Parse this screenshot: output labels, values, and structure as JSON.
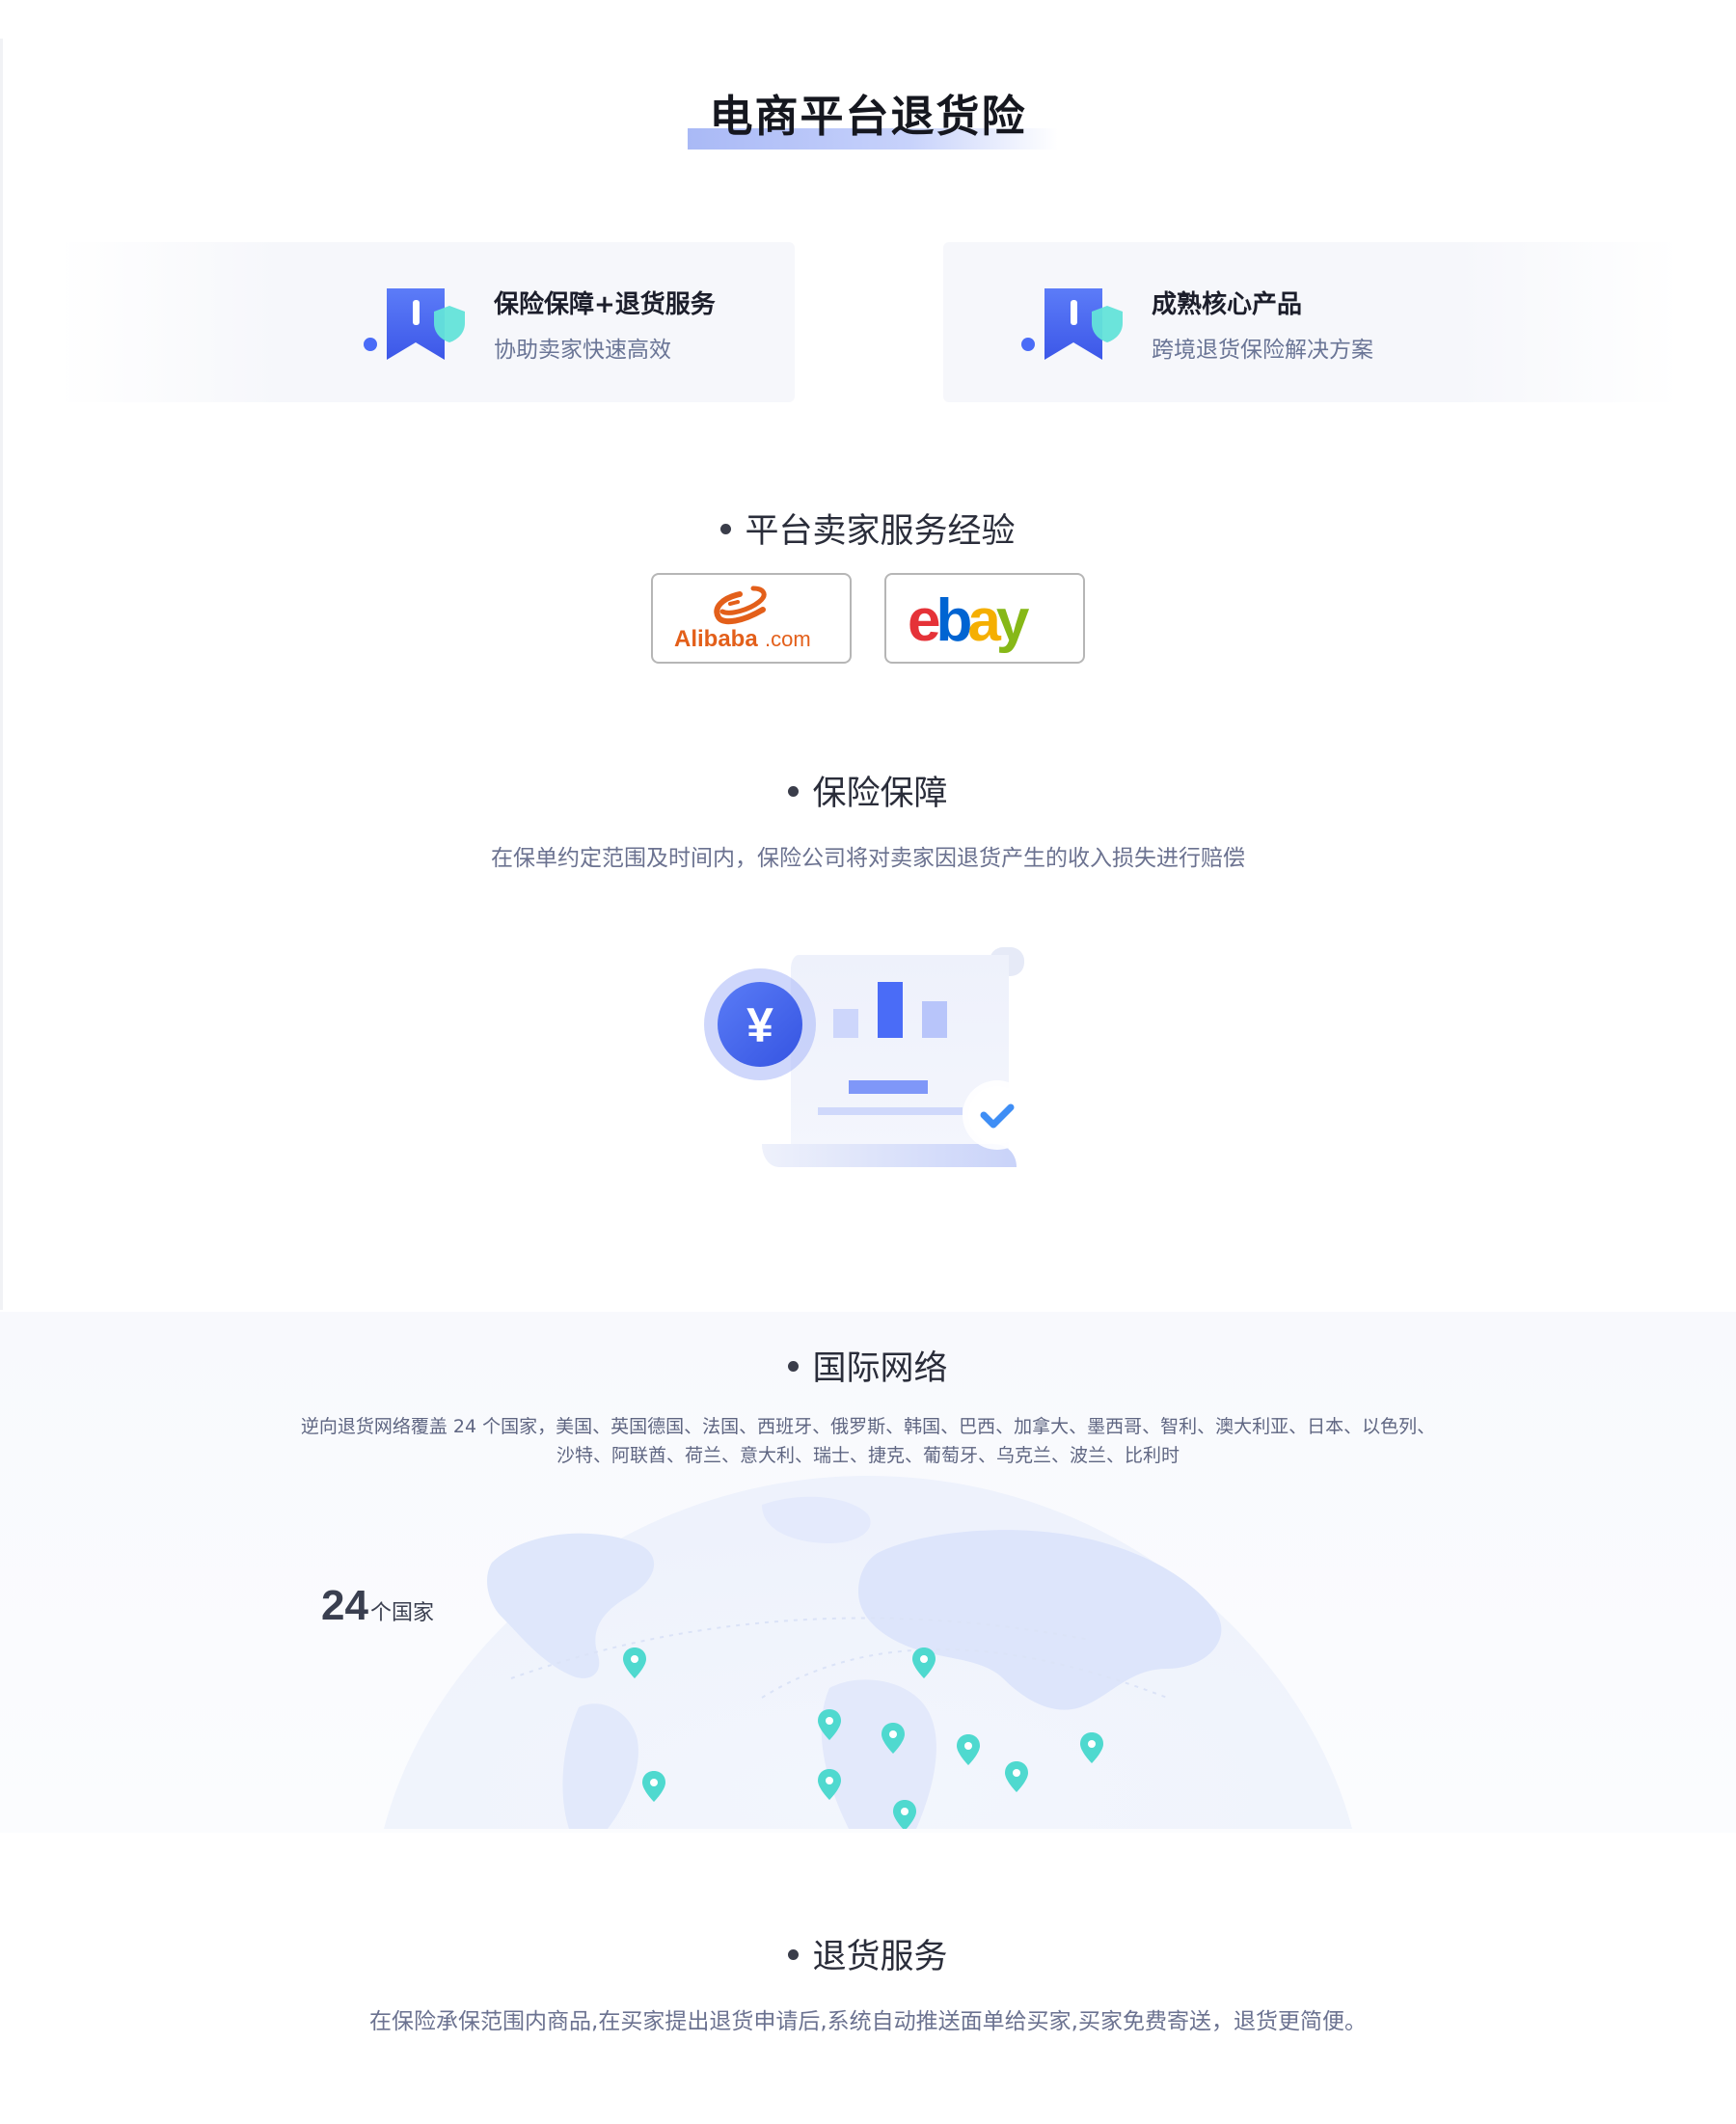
{
  "page": {
    "title": "电商平台退货险"
  },
  "features": [
    {
      "title": "保险保障+退货服务",
      "subtitle": "协助卖家快速高效",
      "icon": "bookmark-shield-icon"
    },
    {
      "title": "成熟核心产品",
      "subtitle": "跨境退货保险解决方案",
      "icon": "bookmark-shield-icon"
    }
  ],
  "platform": {
    "heading": "平台卖家服务经验",
    "logos": [
      {
        "name": "Alibaba.com",
        "wordmark": "Alibaba",
        "suffix": ".com"
      },
      {
        "name": "ebay",
        "letters": [
          "e",
          "b",
          "a",
          "y"
        ]
      }
    ]
  },
  "guarantee": {
    "heading": "保险保障",
    "description": "在保单约定范围及时间内，保险公司将对卖家因退货产生的收入损失进行赔偿",
    "illustration": "document-chart-yuan-icon",
    "currency_symbol": "¥"
  },
  "network": {
    "heading": "国际网络",
    "description_line1": "逆向退货网络覆盖 24 个国家，美国、英国德国、法国、西班牙、俄罗斯、韩国、巴西、加拿大、墨西哥、智利、澳大利亚、日本、以色列、",
    "description_line2": "沙特、阿联酋、荷兰、意大利、瑞士、捷克、葡萄牙、乌克兰、波兰、比利时",
    "count": "24",
    "count_unit": "个国家",
    "map_icon": "world-map-icon",
    "pin_icon": "location-pin-icon"
  },
  "returns": {
    "heading": "退货服务",
    "description": "在保险承保范围内商品,在买家提出退货申请后,系统自动推送面单给买家,买家免费寄送，退货更简便。"
  },
  "colors": {
    "accent_blue": "#4a6cf7",
    "shield_teal": "#5ee0d6",
    "pin_teal": "#4fd9cf",
    "ebay_red": "#e53238",
    "ebay_blue": "#0064d2",
    "ebay_yellow": "#f5af02",
    "ebay_green": "#86b817",
    "alibaba_orange": "#e35f1a"
  }
}
